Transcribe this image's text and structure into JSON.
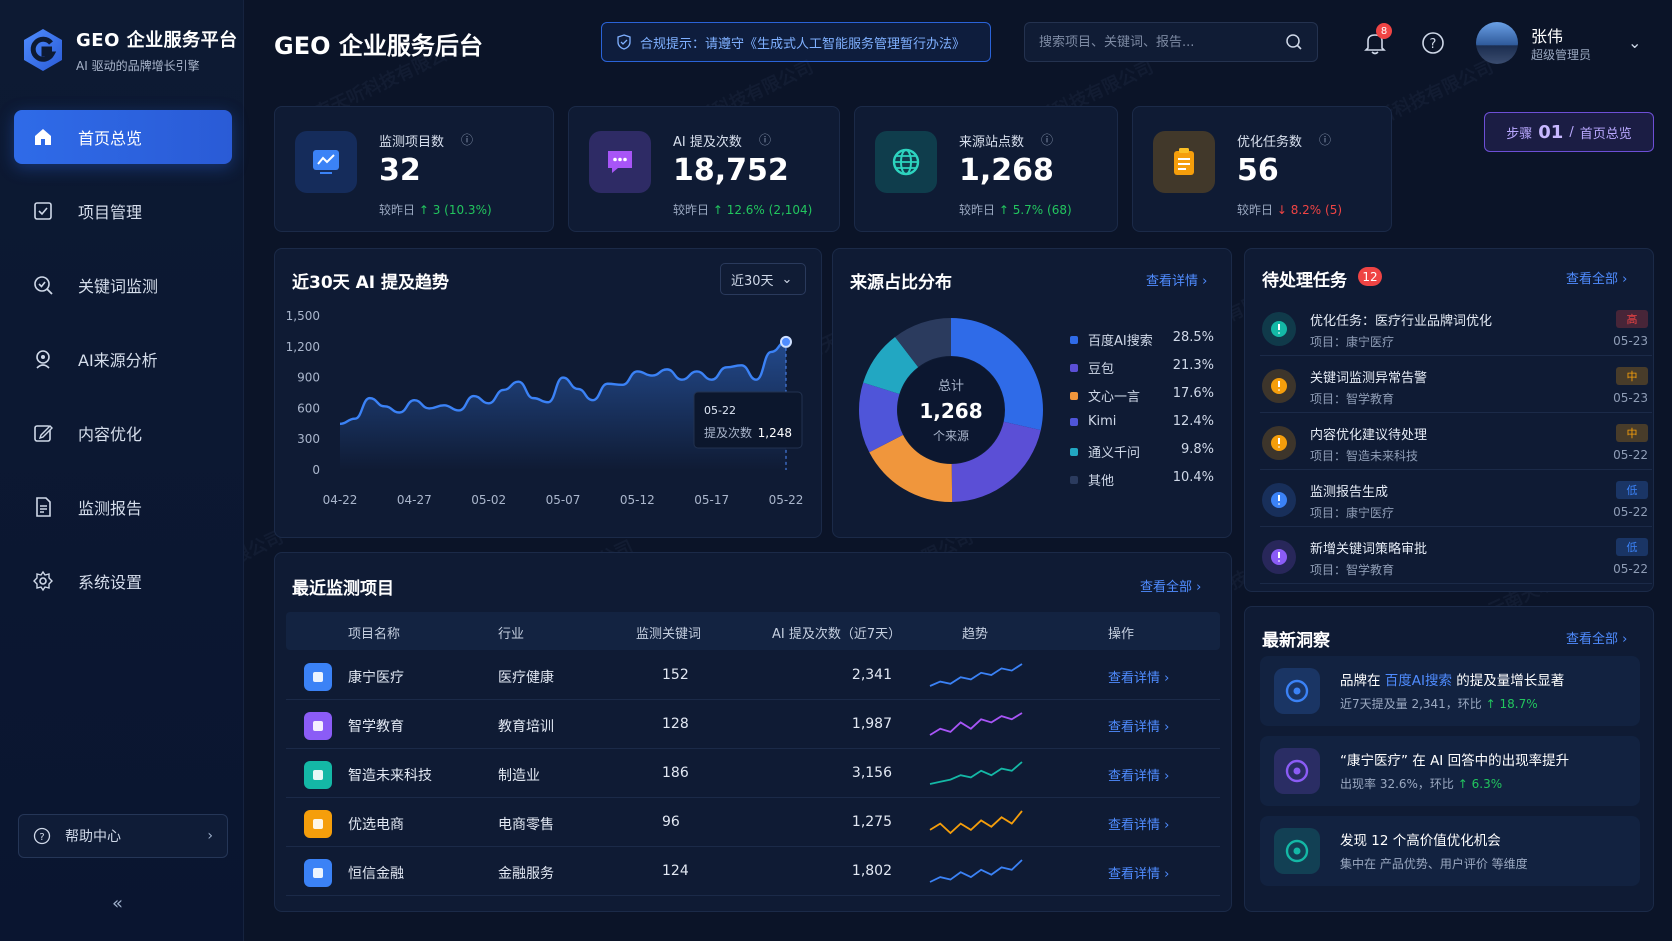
{
  "brand": {
    "title": "GEO 企业服务平台",
    "subtitle": "AI 驱动的品牌增长引擎"
  },
  "sidebar": {
    "items": [
      {
        "label": "首页总览",
        "icon": "home-icon",
        "active": true
      },
      {
        "label": "项目管理",
        "icon": "project-icon"
      },
      {
        "label": "关键词监测",
        "icon": "keyword-search-icon"
      },
      {
        "label": "AI来源分析",
        "icon": "source-analysis-icon"
      },
      {
        "label": "内容优化",
        "icon": "edit-icon"
      },
      {
        "label": "监测报告",
        "icon": "report-icon"
      },
      {
        "label": "系统设置",
        "icon": "gear-icon"
      }
    ],
    "help": "帮助中心",
    "collapse": "«"
  },
  "header": {
    "title": "GEO 企业服务后台",
    "notice": "合规提示：请遵守《生成式人工智能服务管理暂行办法》",
    "search_placeholder": "搜索项目、关键词、报告...",
    "notifications": "8",
    "user_name": "张伟",
    "user_role": "超级管理员"
  },
  "stats": [
    {
      "label": "监测项目数",
      "value": "32",
      "cmp_prefix": "较昨日",
      "cmp": "↑ 3 (10.3%)",
      "dir": "up",
      "color": "#2f6be8"
    },
    {
      "label": "AI 提及次数",
      "value": "18,752",
      "cmp_prefix": "较昨日",
      "cmp": "↑ 12.6% (2,104)",
      "dir": "up",
      "color": "#8b5cf6"
    },
    {
      "label": "来源站点数",
      "value": "1,268",
      "cmp_prefix": "较昨日",
      "cmp": "↑ 5.7% (68)",
      "dir": "up",
      "color": "#14b8a6"
    },
    {
      "label": "优化任务数",
      "value": "56",
      "cmp_prefix": "较昨日",
      "cmp": "↓ 8.2% (5)",
      "dir": "down",
      "color": "#f59e0b"
    }
  ],
  "step": {
    "prefix": "步骤",
    "num": "01",
    "sep": "/",
    "label": "首页总览"
  },
  "trend": {
    "title": "近30天 AI 提及趋势",
    "range": "近30天",
    "tooltip_date": "05-22",
    "tooltip_label": "提及次数",
    "tooltip_value": "1,248"
  },
  "source": {
    "title": "来源占比分布",
    "link": "查看详情 ›",
    "center_label": "总计",
    "center_value": "1,268",
    "center_unit": "个来源"
  },
  "tasks": {
    "title": "待处理任务",
    "count": "12",
    "link": "查看全部 ›",
    "items": [
      {
        "title": "优化任务：医疗行业品牌词优化",
        "project": "项目：康宁医疗",
        "tag": "高",
        "date": "05-23",
        "color": "#14b8a6",
        "tag_color": "#ef4444"
      },
      {
        "title": "关键词监测异常告警",
        "project": "项目：智学教育",
        "tag": "中",
        "date": "05-23",
        "color": "#f59e0b",
        "tag_color": "#f59e0b"
      },
      {
        "title": "内容优化建议待处理",
        "project": "项目：智造未来科技",
        "tag": "中",
        "date": "05-22",
        "color": "#f59e0b",
        "tag_color": "#f59e0b"
      },
      {
        "title": "监测报告生成",
        "project": "项目：康宁医疗",
        "tag": "低",
        "date": "05-22",
        "color": "#3b82f6",
        "tag_color": "#3b82f6"
      },
      {
        "title": "新增关键词策略审批",
        "project": "项目：智学教育",
        "tag": "低",
        "date": "05-22",
        "color": "#8b5cf6",
        "tag_color": "#3b82f6"
      }
    ]
  },
  "projects": {
    "title": "最近监测项目",
    "link": "查看全部 ›",
    "headers": [
      "项目名称",
      "行业",
      "监测关键词",
      "AI 提及次数（近7天）",
      "趋势",
      "操作"
    ],
    "rows": [
      {
        "name": "康宁医疗",
        "industry": "医疗健康",
        "keywords": "152",
        "mentions": "2,341",
        "action": "查看详情 ›",
        "color": "#3b82f6",
        "icon": "medical-cross-icon"
      },
      {
        "name": "智学教育",
        "industry": "教育培训",
        "keywords": "128",
        "mentions": "1,987",
        "action": "查看详情 ›",
        "color": "#8b5cf6",
        "icon": "graduation-cap-icon"
      },
      {
        "name": "智造未来科技",
        "industry": "制造业",
        "keywords": "186",
        "mentions": "3,156",
        "action": "查看详情 ›",
        "color": "#14b8a6",
        "icon": "gear-icon"
      },
      {
        "name": "优选电商",
        "industry": "电商零售",
        "keywords": "96",
        "mentions": "1,275",
        "action": "查看详情 ›",
        "color": "#f59e0b",
        "icon": "shopping-bag-icon"
      },
      {
        "name": "恒信金融",
        "industry": "金融服务",
        "keywords": "124",
        "mentions": "1,802",
        "action": "查看详情 ›",
        "color": "#3b82f6",
        "icon": "bank-icon"
      }
    ]
  },
  "insights": {
    "title": "最新洞察",
    "link": "查看全部 ›",
    "items": [
      {
        "pre": "品牌在 ",
        "hl": "百度AI搜索",
        "post": " 的提及量增长显著",
        "sub_pre": "近7天提及量 2,341，环比 ",
        "sub_up": "↑ 18.7%",
        "color": "#3b82f6",
        "icon": "growth-chart-icon"
      },
      {
        "pre": "“康宁医疗” 在 AI 回答中的出现率提升",
        "hl": "",
        "post": "",
        "sub_pre": "出现率 32.6%，环比 ",
        "sub_up": "↑ 6.3%",
        "color": "#8b5cf6",
        "icon": "star-icon"
      },
      {
        "pre": "发现 12 个高价值优化机会",
        "hl": "",
        "post": "",
        "sub_pre": "集中在 产品优势、用户评价 等维度",
        "sub_up": "",
        "color": "#14b8a6",
        "icon": "lightbulb-icon"
      }
    ]
  },
  "watermark": "云南天听科技有限公司",
  "chart_data": [
    {
      "type": "line",
      "title": "近30天 AI 提及趋势",
      "x_ticks": [
        "04-22",
        "04-27",
        "05-02",
        "05-07",
        "05-12",
        "05-17",
        "05-22"
      ],
      "ylim": [
        0,
        1500
      ],
      "y_ticks": [
        0,
        300,
        600,
        900,
        1200,
        1500
      ],
      "x": [
        "04-22",
        "04-23",
        "04-24",
        "04-25",
        "04-26",
        "04-27",
        "04-28",
        "04-29",
        "04-30",
        "05-01",
        "05-02",
        "05-03",
        "05-04",
        "05-05",
        "05-06",
        "05-07",
        "05-08",
        "05-09",
        "05-10",
        "05-11",
        "05-12",
        "05-13",
        "05-14",
        "05-15",
        "05-16",
        "05-17",
        "05-18",
        "05-19",
        "05-20",
        "05-21",
        "05-22"
      ],
      "values": [
        450,
        500,
        700,
        620,
        560,
        680,
        600,
        630,
        580,
        720,
        650,
        780,
        860,
        700,
        660,
        900,
        790,
        680,
        840,
        830,
        960,
        920,
        980,
        880,
        960,
        880,
        1000,
        1020,
        880,
        1150,
        1248
      ],
      "grid": false
    },
    {
      "type": "pie",
      "title": "来源占比分布",
      "categories": [
        "百度AI搜索",
        "豆包",
        "文心一言",
        "Kimi",
        "通义千问",
        "其他"
      ],
      "values": [
        28.5,
        21.3,
        17.6,
        12.4,
        9.8,
        10.4
      ],
      "labels": [
        "28.5%",
        "21.3%",
        "17.6%",
        "12.4%",
        "9.8%",
        "10.4%"
      ],
      "colors": [
        "#2f6be8",
        "#5b4fd6",
        "#f0963c",
        "#4f55d9",
        "#22a7c2",
        "#2b3b5e"
      ],
      "legend": "right"
    }
  ],
  "sparklines": [
    {
      "color": "#3b82f6",
      "values": [
        2,
        3,
        2.5,
        4,
        3.5,
        5,
        4.5,
        6,
        5.5,
        7
      ]
    },
    {
      "color": "#a855f7",
      "values": [
        3,
        4,
        3.5,
        5,
        4,
        5.5,
        5,
        6,
        5.5,
        6.5
      ]
    },
    {
      "color": "#14b8a6",
      "values": [
        2,
        2.5,
        3,
        4,
        3.5,
        5,
        4,
        5.5,
        5,
        7
      ]
    },
    {
      "color": "#f59e0b",
      "values": [
        4,
        5,
        3.5,
        5,
        4,
        5.5,
        4.5,
        6,
        5,
        7
      ]
    },
    {
      "color": "#3b82f6",
      "values": [
        2,
        3,
        2.5,
        4,
        3,
        4.5,
        3.5,
        5,
        4.5,
        6.5
      ]
    }
  ]
}
